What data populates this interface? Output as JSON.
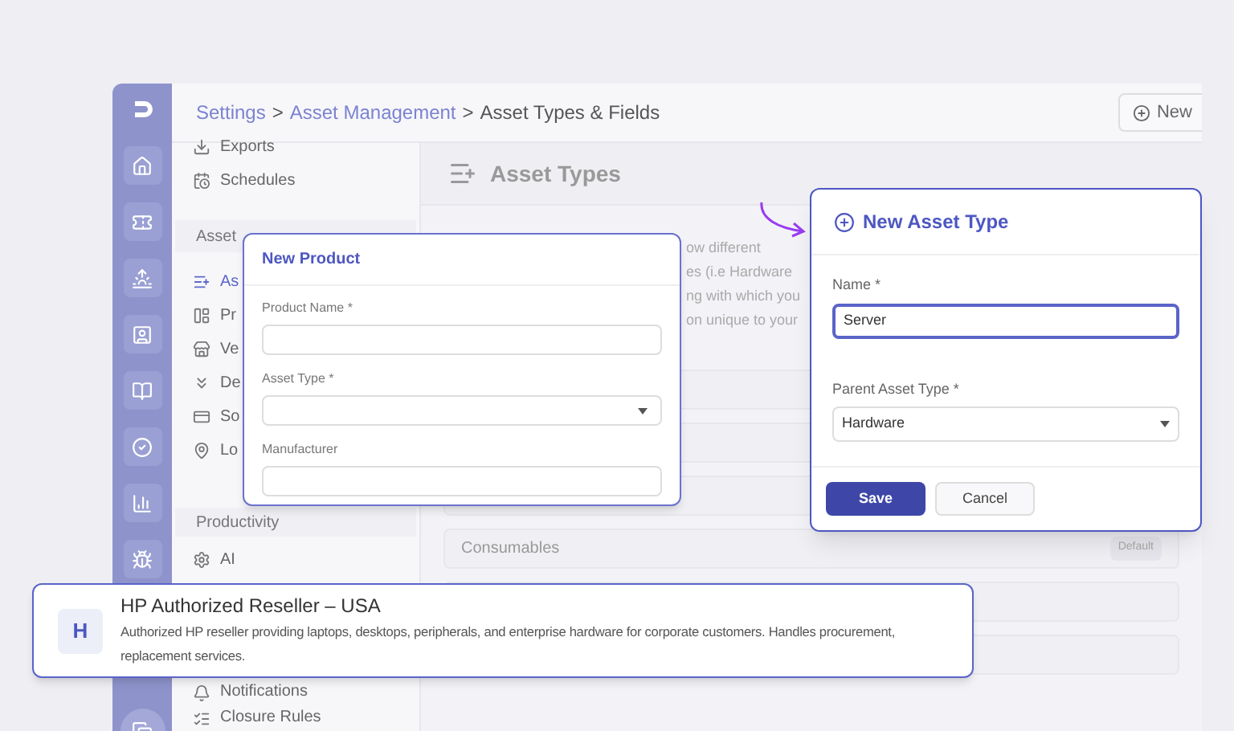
{
  "breadcrumb": [
    {
      "label": "Settings",
      "kind": "link"
    },
    {
      "label": ">",
      "kind": "sep"
    },
    {
      "label": "Asset Management",
      "kind": "link"
    },
    {
      "label": ">",
      "kind": "sep"
    },
    {
      "label": "Asset Types & Fields",
      "kind": "current"
    }
  ],
  "header_button": {
    "label": "New"
  },
  "sidebar": {
    "top_items": [
      {
        "label": "Exports"
      },
      {
        "label": "Schedules"
      }
    ],
    "sections": [
      {
        "title": "Asset",
        "items": [
          {
            "label": "As",
            "selected": true
          },
          {
            "label": "Pr",
            "selected": false
          },
          {
            "label": "Ve",
            "selected": false
          },
          {
            "label": "De",
            "selected": false
          },
          {
            "label": "So",
            "selected": false
          },
          {
            "label": "Lo",
            "selected": false
          }
        ]
      },
      {
        "title": "Productivity",
        "items": [
          {
            "label": "AI",
            "selected": false
          }
        ]
      }
    ],
    "bottom_items": [
      {
        "label": "Notifications"
      },
      {
        "label": "Closure Rules"
      }
    ]
  },
  "content": {
    "title": "Asset Types",
    "description_lines": [
      "ow different",
      "es (i.e Hardware",
      "ng with which you",
      "on unique to your"
    ],
    "rows": [
      {
        "kind": "empty"
      },
      {
        "kind": "empty"
      },
      {
        "kind": "empty"
      },
      {
        "kind": "named",
        "label": "Consumables",
        "badge": "Default"
      },
      {
        "kind": "empty"
      },
      {
        "kind": "empty"
      }
    ]
  },
  "new_product_dialog": {
    "title": "New Product",
    "fields": [
      {
        "label": "Product Name *",
        "kind": "text"
      },
      {
        "label": "Asset Type *",
        "kind": "select"
      },
      {
        "label": "Manufacturer",
        "kind": "text"
      }
    ]
  },
  "new_asset_type_dialog": {
    "title": "New Asset Type",
    "fields": [
      {
        "label": "Name *",
        "kind": "text",
        "value": "Server",
        "focused": true
      },
      {
        "label": "Parent Asset Type *",
        "kind": "select",
        "value": "Hardware",
        "focused": false
      }
    ],
    "buttons": [
      {
        "label": "Save",
        "kind": "primary"
      },
      {
        "label": "Cancel",
        "kind": "secondary"
      }
    ]
  },
  "vendor_card": {
    "initial": "H",
    "title": "HP Authorized Reseller – USA",
    "description_lines": [
      "Authorized HP reseller providing laptops, desktops, peripherals, and enterprise hardware for corporate customers. Handles procurement,",
      "replacement services."
    ]
  }
}
